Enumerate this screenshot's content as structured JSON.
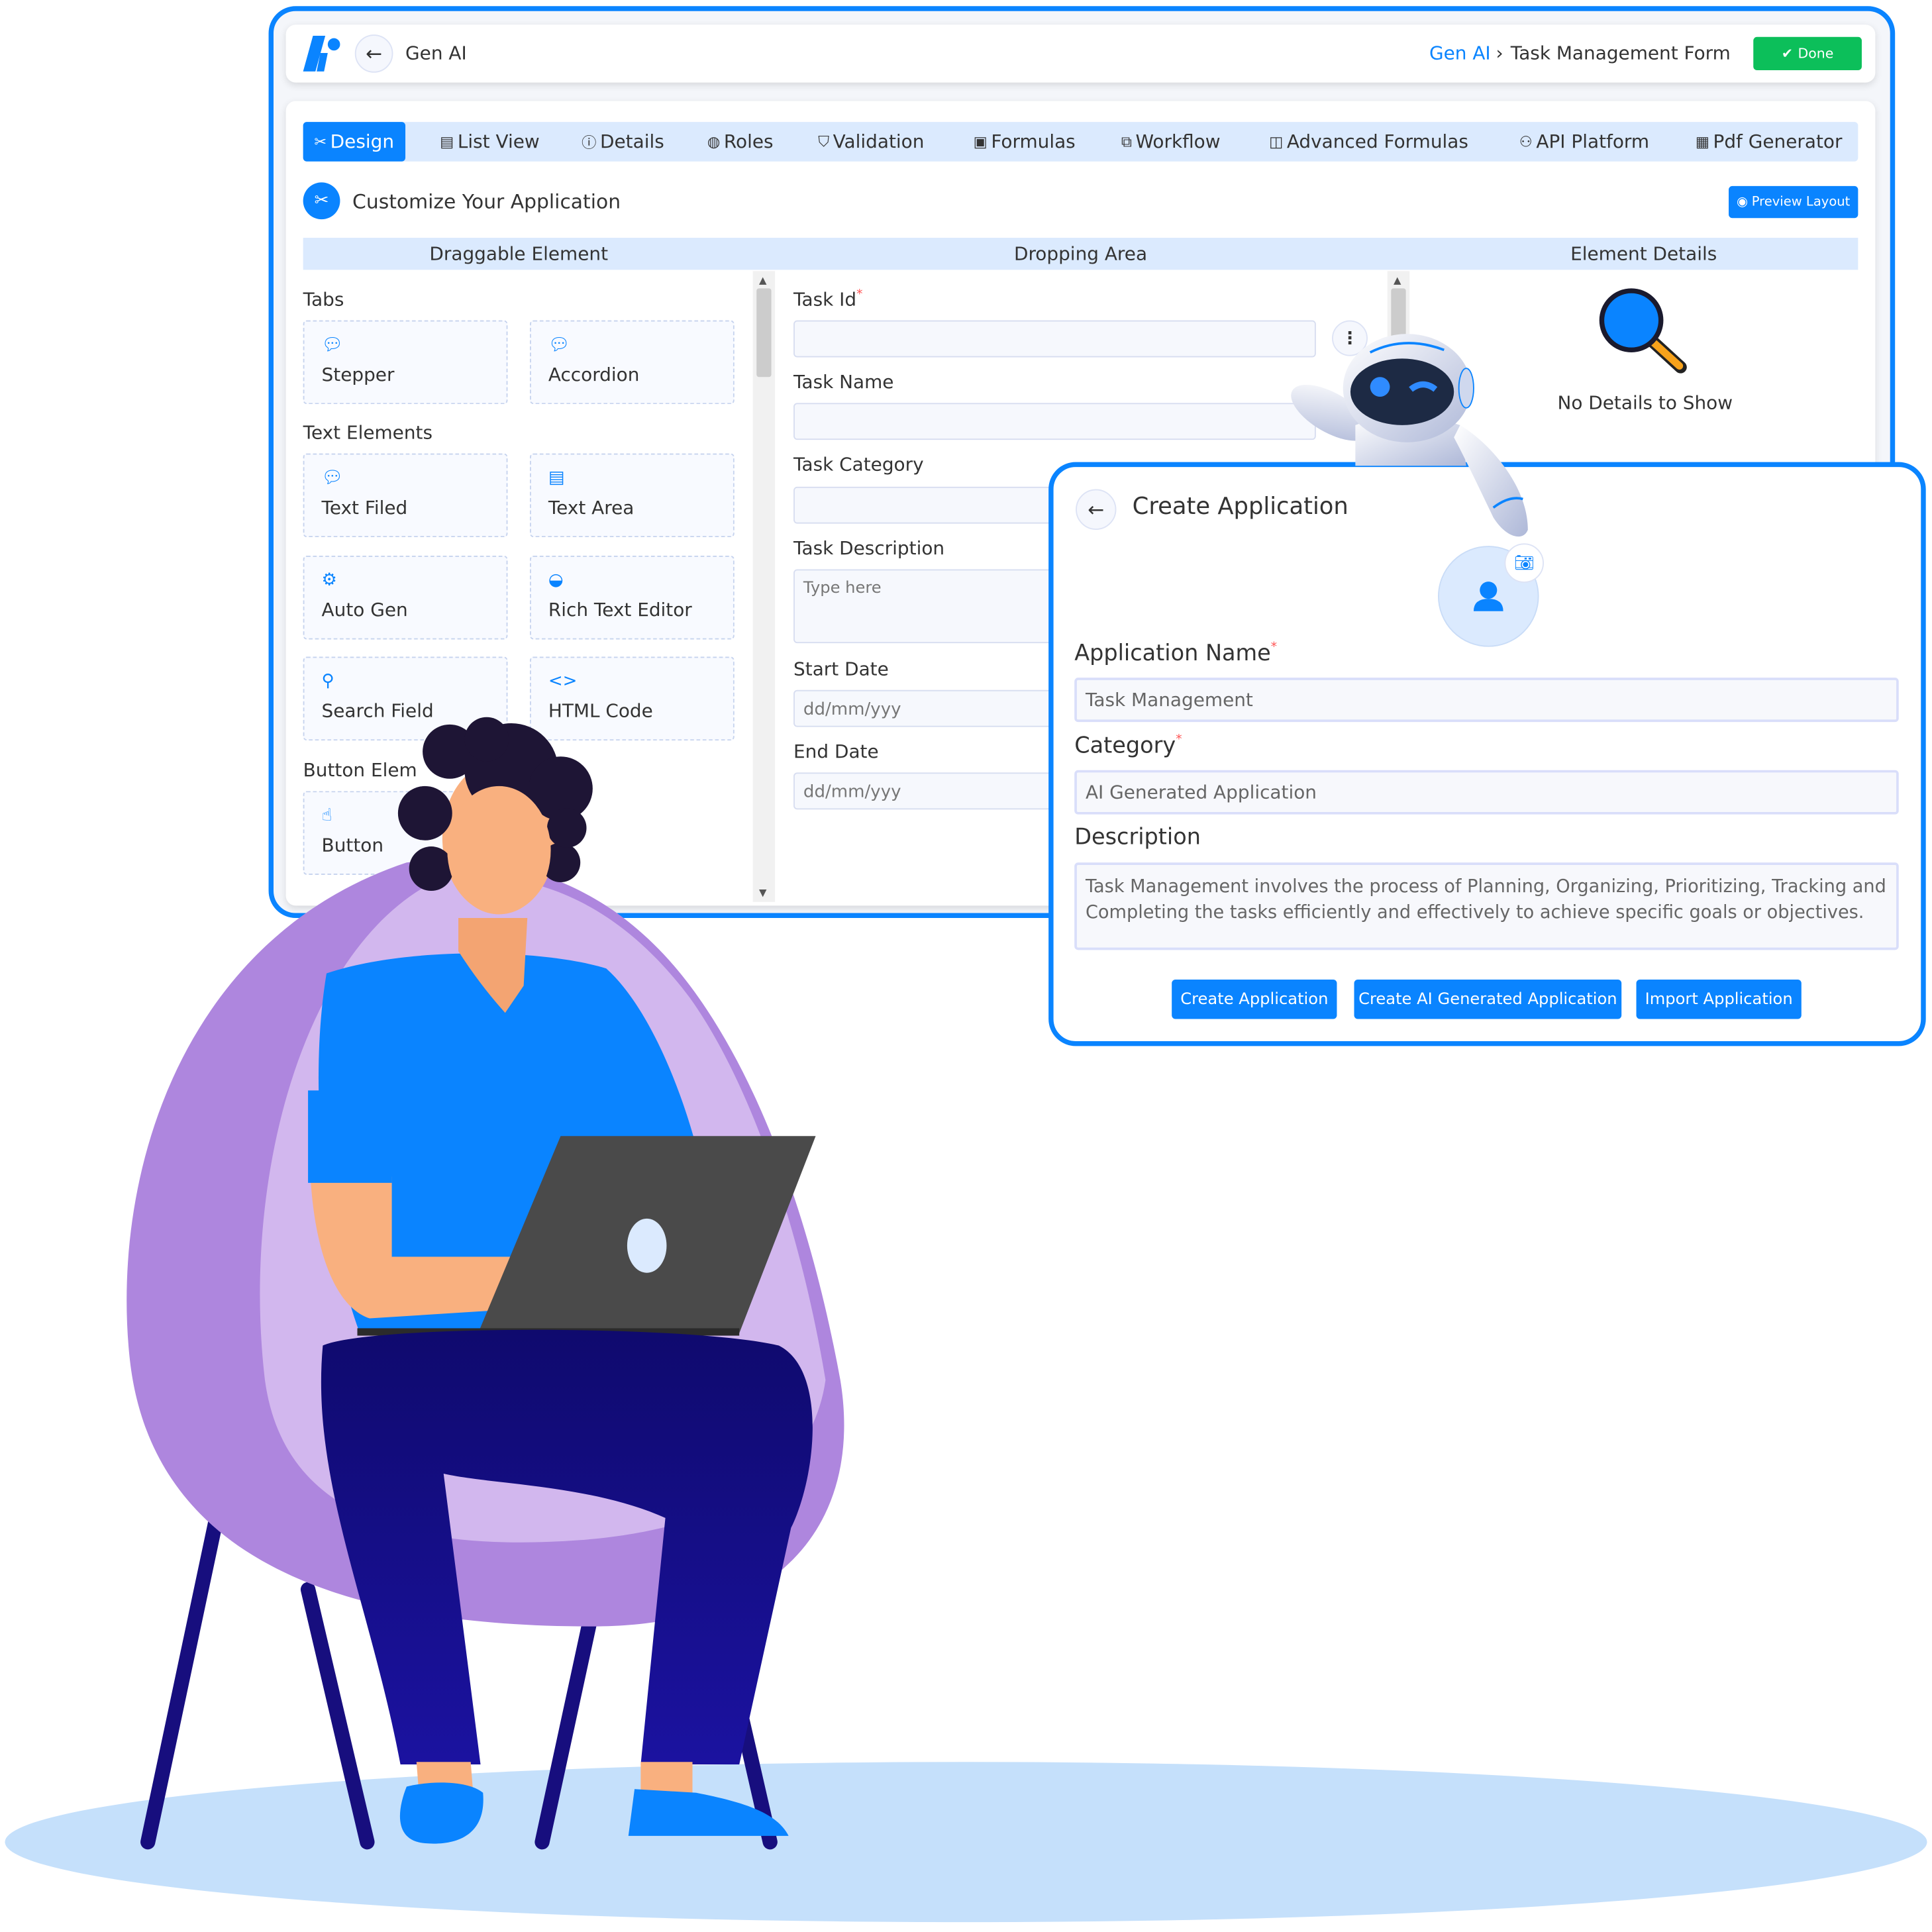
{
  "header": {
    "app_title": "Gen AI",
    "breadcrumb_root": "Gen AI",
    "breadcrumb_separator": "›",
    "breadcrumb_current": "Task Management Form",
    "done_label": "Done"
  },
  "tabs": [
    {
      "label": "Design",
      "icon": "design-icon",
      "active": true
    },
    {
      "label": "List View",
      "icon": "list-icon"
    },
    {
      "label": "Details",
      "icon": "info-icon"
    },
    {
      "label": "Roles",
      "icon": "roles-icon"
    },
    {
      "label": "Validation",
      "icon": "shield-check-icon"
    },
    {
      "label": "Formulas",
      "icon": "formula-icon"
    },
    {
      "label": "Workflow",
      "icon": "workflow-icon"
    },
    {
      "label": "Advanced Formulas",
      "icon": "advanced-formula-icon"
    },
    {
      "label": "API Platform",
      "icon": "api-icon"
    },
    {
      "label": "Pdf Generator",
      "icon": "pdf-icon"
    }
  ],
  "customize": {
    "title": "Customize Your Application",
    "preview_label": "Preview Layout"
  },
  "columns": {
    "draggable": "Draggable Element",
    "dropping": "Dropping Area",
    "details": "Element Details"
  },
  "palette": {
    "sections": [
      "Tabs",
      "Text Elements",
      "Button Elem"
    ],
    "items": [
      "Stepper",
      "Accordion",
      "Text Filed",
      "Text Area",
      "Auto Gen",
      "Rich Text Editor",
      "Search Field",
      "HTML Code",
      "Button"
    ]
  },
  "form": {
    "fields": [
      {
        "label": "Task Id",
        "required": true,
        "value": ""
      },
      {
        "label": "Task Name",
        "value": ""
      },
      {
        "label": "Task Category",
        "value": ""
      },
      {
        "label": "Task Description",
        "placeholder": "Type here"
      },
      {
        "label": "Start Date",
        "placeholder": "dd/mm/yyy"
      },
      {
        "label": "End Date",
        "placeholder": "dd/mm/yyy"
      }
    ],
    "required_mark": "*"
  },
  "element_details": {
    "empty_text": "No Details to Show"
  },
  "create_app": {
    "title": "Create Application",
    "name_label": "Application Name",
    "name_value": "Task Management",
    "category_label": "Category",
    "category_value": "AI Generated Application",
    "description_label": "Description",
    "description_value": "Task Management involves the process of Planning, Organizing, Prioritizing, Tracking and Completing the tasks efficiently and effectively to achieve specific goals or objectives.",
    "buttons": [
      "Create Application",
      "Create AI Generated Application",
      "Import Application"
    ]
  },
  "colors": {
    "accent": "#0a84ff",
    "done": "#0cbf5a",
    "tab_bg": "#dbeafe",
    "required": "#ff5555"
  }
}
